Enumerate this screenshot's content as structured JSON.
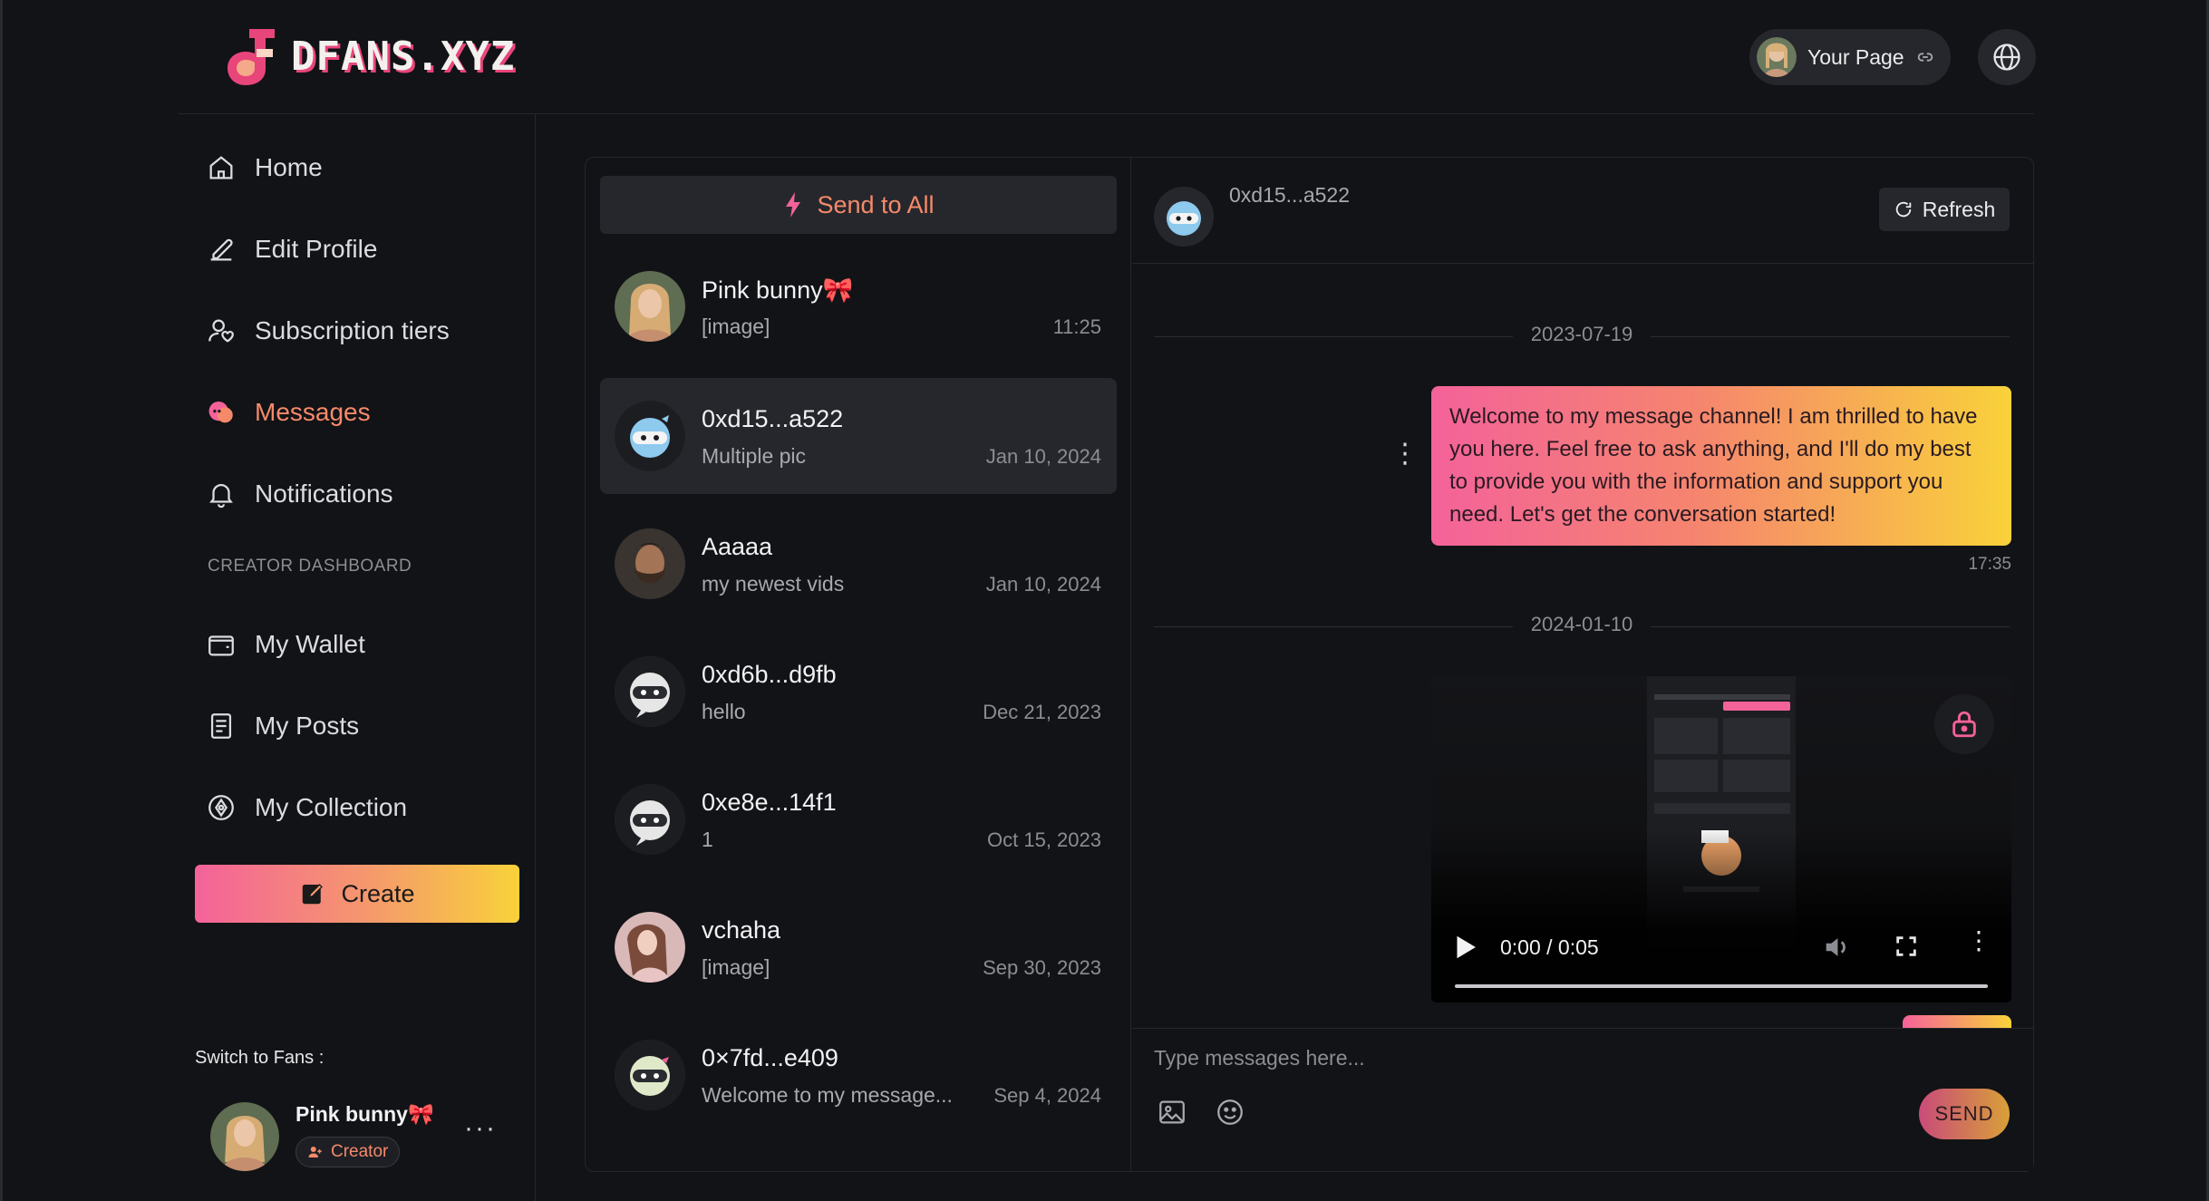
{
  "header": {
    "logo_text": "DFANS.XYZ",
    "your_page_label": "Your Page",
    "icons": [
      "link-icon",
      "globe-icon"
    ]
  },
  "sidebar": {
    "items": [
      {
        "label": "Home",
        "icon": "home-icon"
      },
      {
        "label": "Edit Profile",
        "icon": "pencil-icon"
      },
      {
        "label": "Subscription tiers",
        "icon": "user-heart-icon"
      },
      {
        "label": "Messages",
        "icon": "chat-bubbles-icon",
        "active": true
      },
      {
        "label": "Notifications",
        "icon": "bell-icon"
      }
    ],
    "section_label": "CREATOR DASHBOARD",
    "creator_items": [
      {
        "label": "My Wallet",
        "icon": "wallet-icon"
      },
      {
        "label": "My Posts",
        "icon": "document-icon"
      },
      {
        "label": "My Collection",
        "icon": "collection-icon"
      }
    ],
    "create_label": "Create",
    "switch_label": "Switch to Fans :",
    "profile": {
      "name": "Pink bunny",
      "emoji": "🎀",
      "badge": "Creator"
    }
  },
  "conversations": {
    "send_all_label": "Send to All",
    "items": [
      {
        "name": "Pink bunny",
        "emoji": "🎀",
        "preview": "[image]",
        "time": "11:25"
      },
      {
        "name": "0xd15...a522",
        "preview": "Multiple pic",
        "time": "Jan 10, 2024",
        "active": true
      },
      {
        "name": "Aaaaa",
        "preview": "my newest vids",
        "time": "Jan 10, 2024"
      },
      {
        "name": "0xd6b...d9fb",
        "preview": "hello",
        "time": "Dec 21, 2023"
      },
      {
        "name": "0xe8e...14f1",
        "preview": "1",
        "time": "Oct 15, 2023"
      },
      {
        "name": "vchaha",
        "preview": "[image]",
        "time": "Sep 30, 2023"
      },
      {
        "name": "0×7fd...e409",
        "preview": "Welcome to my message...",
        "time": "Sep 4, 2024"
      }
    ]
  },
  "chat": {
    "contact_name": "0xd15...a522",
    "refresh_label": "Refresh",
    "date_1": "2023-07-19",
    "message_1": "Welcome to my message channel! I am thrilled to have you here. Feel free to ask anything, and I'll do my best to provide you with the information and support you need. Let's get the conversation started!",
    "message_1_time": "17:35",
    "date_2": "2024-01-10",
    "video_time": "0:00 / 0:05",
    "composer_placeholder": "Type messages here...",
    "send_label": "SEND"
  },
  "colors": {
    "accent": "#f58a6a",
    "gradient_start": "#f4629a",
    "gradient_end": "#f9d23a",
    "background": "#121316",
    "surface": "#26272c"
  }
}
